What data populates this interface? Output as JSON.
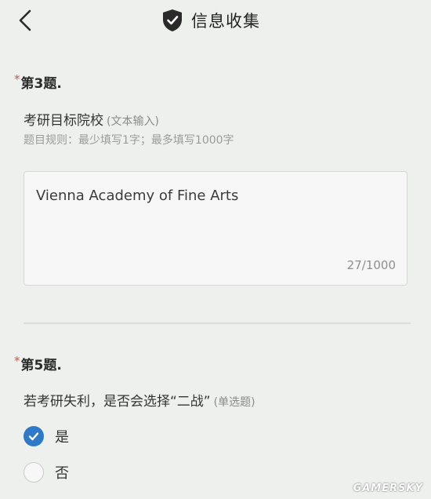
{
  "header": {
    "title": "信息收集",
    "back_icon": "chevron-left-icon",
    "title_icon": "shield-check-icon"
  },
  "question3": {
    "number": "第3题.",
    "required_mark": "*",
    "text": "考研目标院校",
    "type": "(文本输入)",
    "rule": "题目规则：最少填写1字；最多填写1000字",
    "answer": "Vienna Academy of Fine Arts",
    "counter": "27/1000"
  },
  "question5": {
    "number": "第5题.",
    "required_mark": "*",
    "text": "若考研失利，是否会选择“二战”",
    "type": "(单选题)",
    "options": [
      {
        "label": "是",
        "selected": true
      },
      {
        "label": "否",
        "selected": false
      }
    ]
  },
  "watermark": "GAMERSKY",
  "colors": {
    "accent": "#2f79c9",
    "required": "#c85a4a",
    "background": "#eef0ee"
  }
}
